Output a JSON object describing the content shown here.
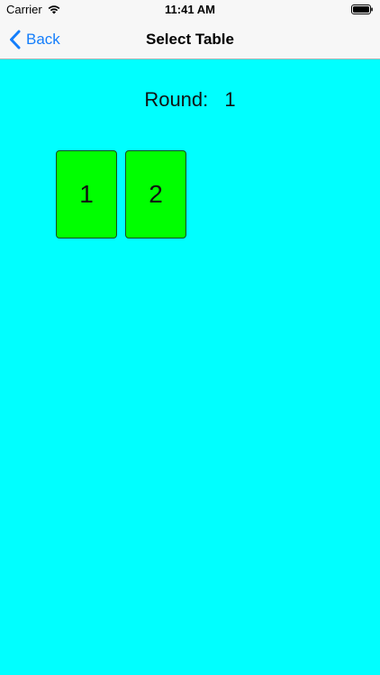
{
  "status_bar": {
    "carrier": "Carrier",
    "time": "11:41 AM",
    "icons": [
      "wifi-icon",
      "battery-icon"
    ]
  },
  "nav": {
    "back_label": "Back",
    "back_icon": "chevron-left-icon",
    "title": "Select Table"
  },
  "round": {
    "label": "Round:",
    "value": "1"
  },
  "tables": [
    {
      "label": "1"
    },
    {
      "label": "2"
    }
  ],
  "colors": {
    "background": "#00ffff",
    "table_card": "#00ff00",
    "accent": "#147efb"
  }
}
